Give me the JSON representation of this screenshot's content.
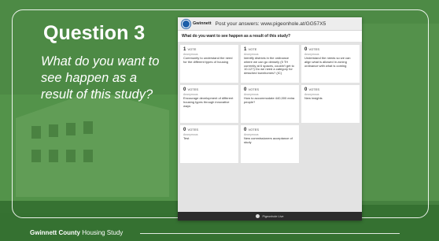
{
  "slide": {
    "title": "Question 3",
    "question": "What do you want to see happen as a result of this study?",
    "footer_bold": "Gwinnett County",
    "footer_rest": "Housing Study"
  },
  "app": {
    "brand": "Gwinnett",
    "header_text": "Post your answers: www.pigeonhole.at/GG57X5",
    "prompt": "What do you want to see happen as a result of this study?",
    "status_bar": "Pigeonhole Live",
    "cards": [
      {
        "count": "1",
        "votes_label": "VOTE",
        "author": "Anonymous",
        "text": "Community to understand the need for the different types of housing"
      },
      {
        "count": "1",
        "votes_label": "VOTE",
        "author": "Anonymous",
        "text": "Identify districts in the ordinance where we can go densely (5 TH currently at 6 spaces, couldn't get to 10-12?) Do we need a category for detached townhomes? (IC)"
      },
      {
        "count": "0",
        "votes_label": "VOTES",
        "author": "Anonymous",
        "text": "Understand the needs so we can align what is allowed in zoning ordinance with what is coming"
      },
      {
        "count": "0",
        "votes_label": "VOTES",
        "author": "Anonymous",
        "text": "Encourage development of different housing types through innovative ways"
      },
      {
        "count": "0",
        "votes_label": "VOTES",
        "author": "Anonymous",
        "text": "How to accommodate 440,000 extra people?"
      },
      {
        "count": "0",
        "votes_label": "VOTES",
        "author": "Anonymous",
        "text": "New insights"
      },
      {
        "count": "0",
        "votes_label": "VOTES",
        "author": "Anonymous",
        "text": "Test"
      },
      {
        "count": "0",
        "votes_label": "VOTES",
        "author": "Anonymous",
        "text": "New commissioners acceptance of study"
      }
    ]
  },
  "colors": {
    "slide_green": "#3f7d3a",
    "app_blue": "#1c5ea8"
  }
}
